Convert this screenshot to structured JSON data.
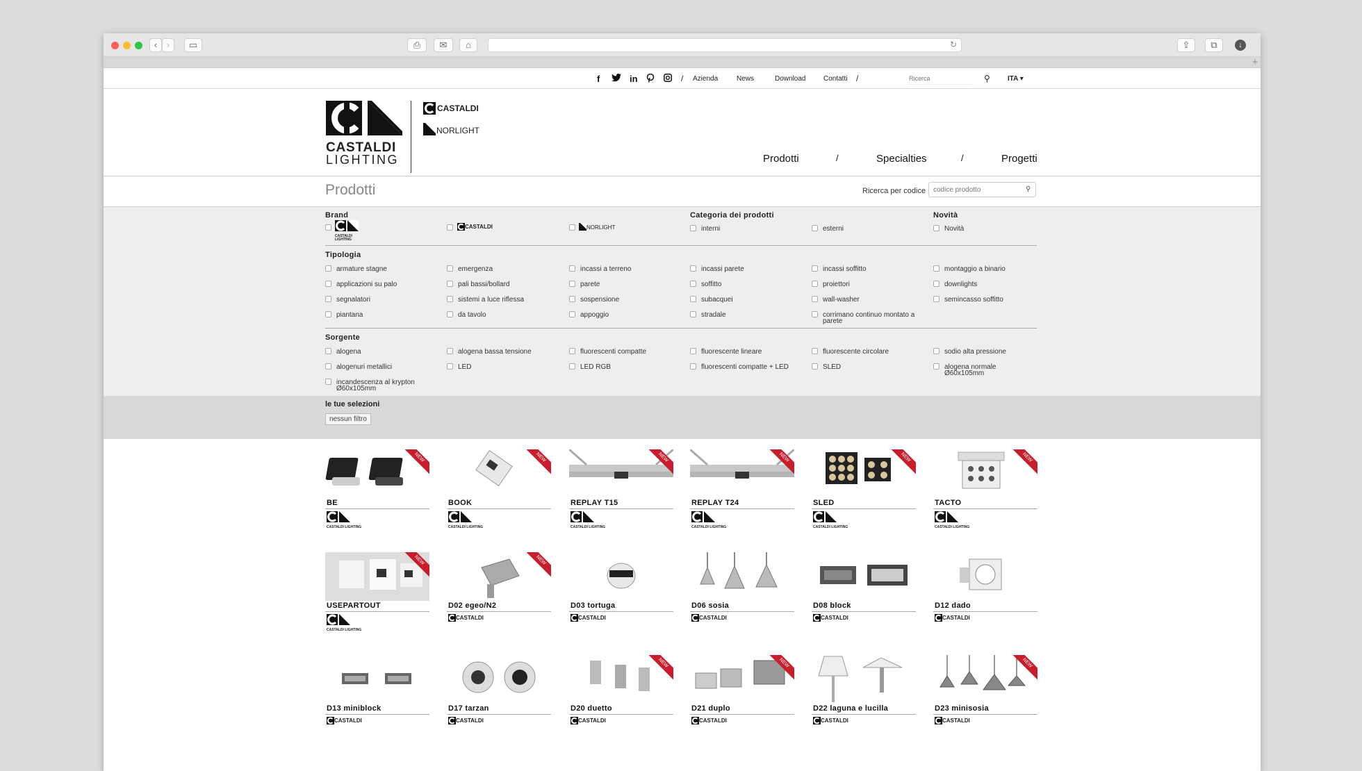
{
  "topbar": {
    "social": [
      "f",
      "t",
      "in",
      "p",
      "ig"
    ],
    "links": [
      "Azienda",
      "News",
      "Download",
      "Contatti"
    ],
    "search_placeholder": "Ricerca",
    "language": "ITA"
  },
  "header": {
    "logo_main_line1": "CASTALDI",
    "logo_main_line2": "LIGHTING",
    "sub_brand_1": "CASTALDI",
    "sub_brand_2": "NORLIGHT",
    "nav": [
      "Prodotti",
      "Specialties",
      "Progetti"
    ]
  },
  "titlebar": {
    "title": "Prodotti",
    "code_label": "Ricerca per codice",
    "code_placeholder": "codice prodotto"
  },
  "filters": {
    "brand_heading": "Brand",
    "brand_castaldi_lighting": "CASTALDI LIGHTING",
    "brand_castaldi": "CASTALDI",
    "brand_norlight": "NORLIGHT",
    "categoria_heading": "Categoria dei prodotti",
    "categoria": [
      "interni",
      "esterni"
    ],
    "novita_heading": "Novità",
    "novita": [
      "Novità"
    ],
    "tipologia_heading": "Tipologia",
    "tipologia": [
      "armature stagne",
      "emergenza",
      "incassi a terreno",
      "incassi parete",
      "incassi soffitto",
      "montaggio a binario",
      "applicazioni su palo",
      "pali bassi/bollard",
      "parete",
      "soffitto",
      "proiettori",
      "downlights",
      "segnalatori",
      "sistemi a luce riflessa",
      "sospensione",
      "subacquei",
      "wall-washer",
      "semincasso soffitto",
      "piantana",
      "da tavolo",
      "appoggio",
      "stradale",
      "corrimano continuo montato a parete"
    ],
    "sorgente_heading": "Sorgente",
    "sorgente": [
      "alogena",
      "alogena bassa tensione",
      "fluorescenti compatte",
      "fluorescente lineare",
      "fluorescente circolare",
      "sodio alta pressione",
      "alogenuri metallici",
      "LED",
      "LED RGB",
      "fluorescenti compatte + LED",
      "SLED",
      "alogena normale Ø60x105mm",
      "incandescenza al krypton Ø60x105mm"
    ]
  },
  "selections": {
    "label": "le tue selezioni",
    "none": "nessun filtro"
  },
  "products": [
    {
      "name": "BE",
      "brand": "CASTALDI LIGHTING",
      "new": true
    },
    {
      "name": "BOOK",
      "brand": "CASTALDI LIGHTING",
      "new": true
    },
    {
      "name": "REPLAY T15",
      "brand": "CASTALDI LIGHTING",
      "new": true
    },
    {
      "name": "REPLAY T24",
      "brand": "CASTALDI LIGHTING",
      "new": true
    },
    {
      "name": "SLED",
      "brand": "CASTALDI LIGHTING",
      "new": true
    },
    {
      "name": "TACTO",
      "brand": "CASTALDI LIGHTING",
      "new": true
    },
    {
      "name": "USEPARTOUT",
      "brand": "CASTALDI LIGHTING",
      "new": true
    },
    {
      "name": "D02 egeo/N2",
      "brand": "CASTALDI",
      "new": true
    },
    {
      "name": "D03 tortuga",
      "brand": "CASTALDI",
      "new": false
    },
    {
      "name": "D06 sosia",
      "brand": "CASTALDI",
      "new": false
    },
    {
      "name": "D08 block",
      "brand": "CASTALDI",
      "new": false
    },
    {
      "name": "D12 dado",
      "brand": "CASTALDI",
      "new": false
    },
    {
      "name": "D13 miniblock",
      "brand": "CASTALDI",
      "new": false
    },
    {
      "name": "D17 tarzan",
      "brand": "CASTALDI",
      "new": false
    },
    {
      "name": "D20 duetto",
      "brand": "CASTALDI",
      "new": true
    },
    {
      "name": "D21 duplo",
      "brand": "CASTALDI",
      "new": true
    },
    {
      "name": "D22 laguna e lucilla",
      "brand": "CASTALDI",
      "new": false
    },
    {
      "name": "D23 minisosia",
      "brand": "CASTALDI",
      "new": true
    }
  ],
  "ribbon_text": "NEW",
  "colors": {
    "ribbon": "#c81e2c",
    "filters_bg": "#eeeeee",
    "selections_bg": "#d9d9d9"
  }
}
